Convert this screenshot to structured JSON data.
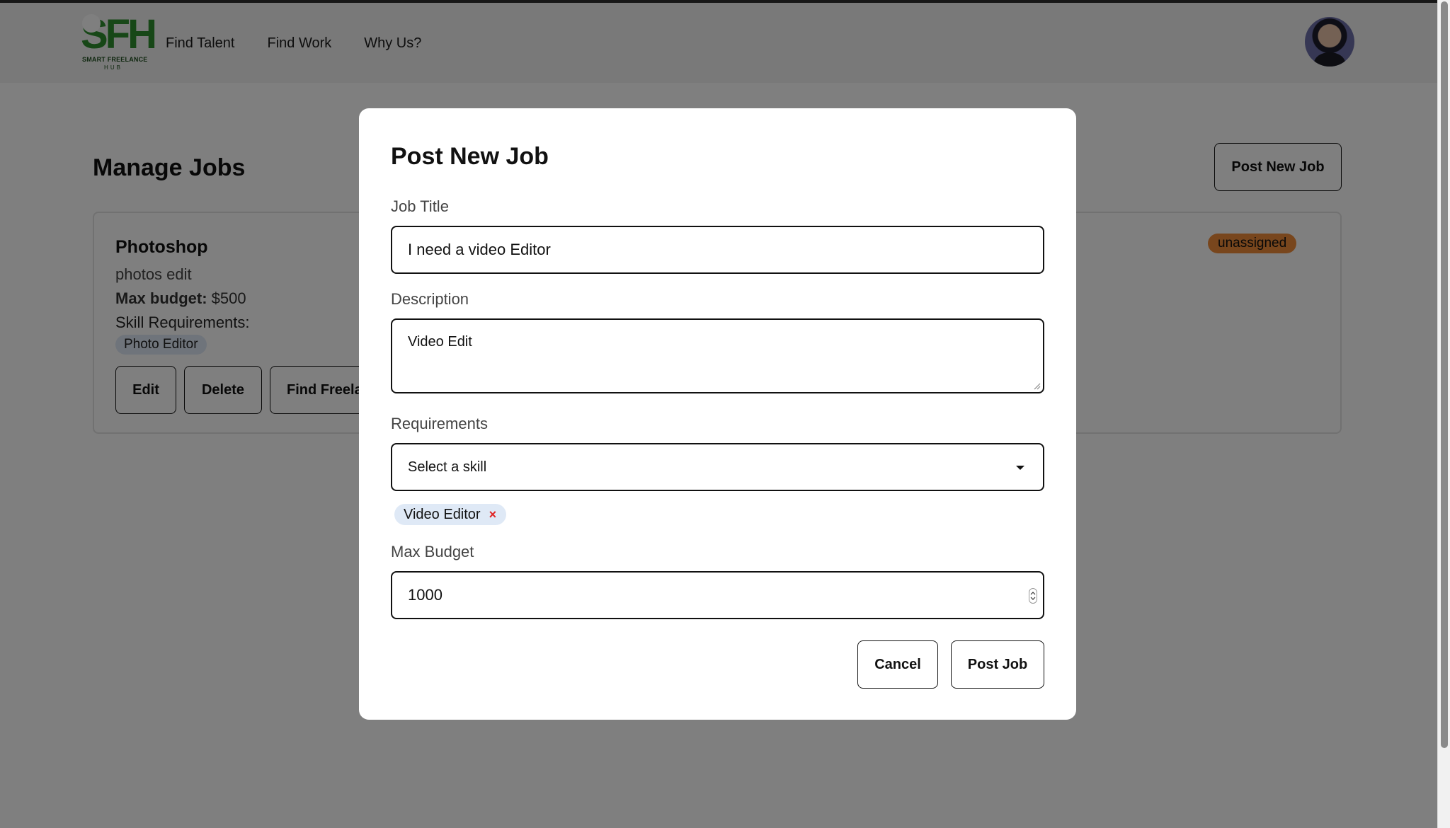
{
  "header": {
    "logo_letters": "SFH",
    "logo_tagline": "SMART FREELANCE",
    "logo_tagline_2": "HUB",
    "nav": [
      "Find Talent",
      "Find Work",
      "Why Us?"
    ]
  },
  "page": {
    "title": "Manage Jobs",
    "post_new_job_label": "Post New Job"
  },
  "job_card": {
    "title": "Photoshop",
    "description": "photos edit",
    "budget_label": "Max budget:",
    "budget_value": " $500",
    "skill_requirements_label": "Skill Requirements:",
    "skills": [
      "Photo Editor"
    ],
    "status": "unassigned",
    "buttons": {
      "edit": "Edit",
      "delete": "Delete",
      "find_freelancers": "Find Freela"
    }
  },
  "modal": {
    "title": "Post New Job",
    "job_title_label": "Job Title",
    "job_title_value": "I need a video Editor",
    "description_label": "Description",
    "description_value": "Video Edit",
    "requirements_label": "Requirements",
    "requirements_select": "Select a skill",
    "selected_skills": [
      "Video Editor"
    ],
    "chip_remove": "×",
    "max_budget_label": "Max Budget",
    "max_budget_value": "1000",
    "cancel_label": "Cancel",
    "post_job_label": "Post Job"
  },
  "colors": {
    "logo_green": "#2f8f2f",
    "status_orange": "#f08d3a",
    "chip_blue": "#dfe9f6",
    "remove_red": "#e02424"
  },
  "icons": [
    "avatar",
    "chevron-down-icon",
    "close-icon",
    "number-spinner-icon",
    "resize-grip-icon"
  ]
}
